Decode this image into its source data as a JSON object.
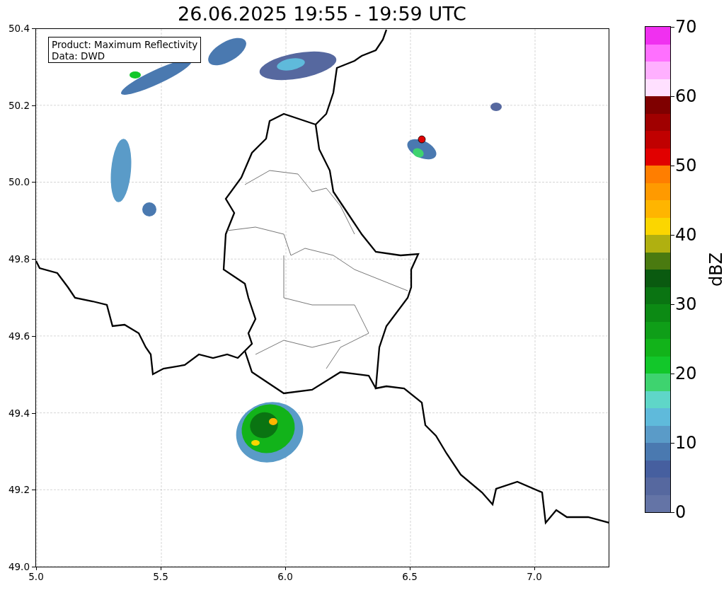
{
  "title": "26.06.2025 19:55 - 19:59 UTC",
  "map": {
    "annotation": [
      "Product: Maximum Reflectivity",
      "Data: DWD"
    ],
    "x_ticks": [
      "5.0",
      "5.5",
      "6.0",
      "6.5",
      "7.0"
    ],
    "y_ticks": [
      "50.4",
      "50.2",
      "50.0",
      "49.8",
      "49.6",
      "49.4",
      "49.2",
      "49.0"
    ]
  },
  "colorbar": {
    "label": "dBZ",
    "ticks": [
      "70",
      "60",
      "50",
      "40",
      "30",
      "20",
      "10",
      "0"
    ],
    "bins": [
      {
        "color": "#6474a6"
      },
      {
        "color": "#56689f"
      },
      {
        "color": "#465f9f"
      },
      {
        "color": "#4a79b0"
      },
      {
        "color": "#5a9bc8"
      },
      {
        "color": "#5fbadb"
      },
      {
        "color": "#5fd6c8"
      },
      {
        "color": "#3ed36f"
      },
      {
        "color": "#12c72a"
      },
      {
        "color": "#12b31a"
      },
      {
        "color": "#0f9e18"
      },
      {
        "color": "#0c8a14"
      },
      {
        "color": "#0a7412"
      },
      {
        "color": "#0a5a10"
      },
      {
        "color": "#4a7a10"
      },
      {
        "color": "#b0b010"
      },
      {
        "color": "#fbd600"
      },
      {
        "color": "#ffb500"
      },
      {
        "color": "#ff9a00"
      },
      {
        "color": "#ff7e00"
      },
      {
        "color": "#e10000"
      },
      {
        "color": "#c00000"
      },
      {
        "color": "#a00000"
      },
      {
        "color": "#7f0000"
      },
      {
        "color": "#ffe0ff"
      },
      {
        "color": "#ffb0ff"
      },
      {
        "color": "#ff70ff"
      },
      {
        "color": "#f030f0"
      }
    ]
  }
}
